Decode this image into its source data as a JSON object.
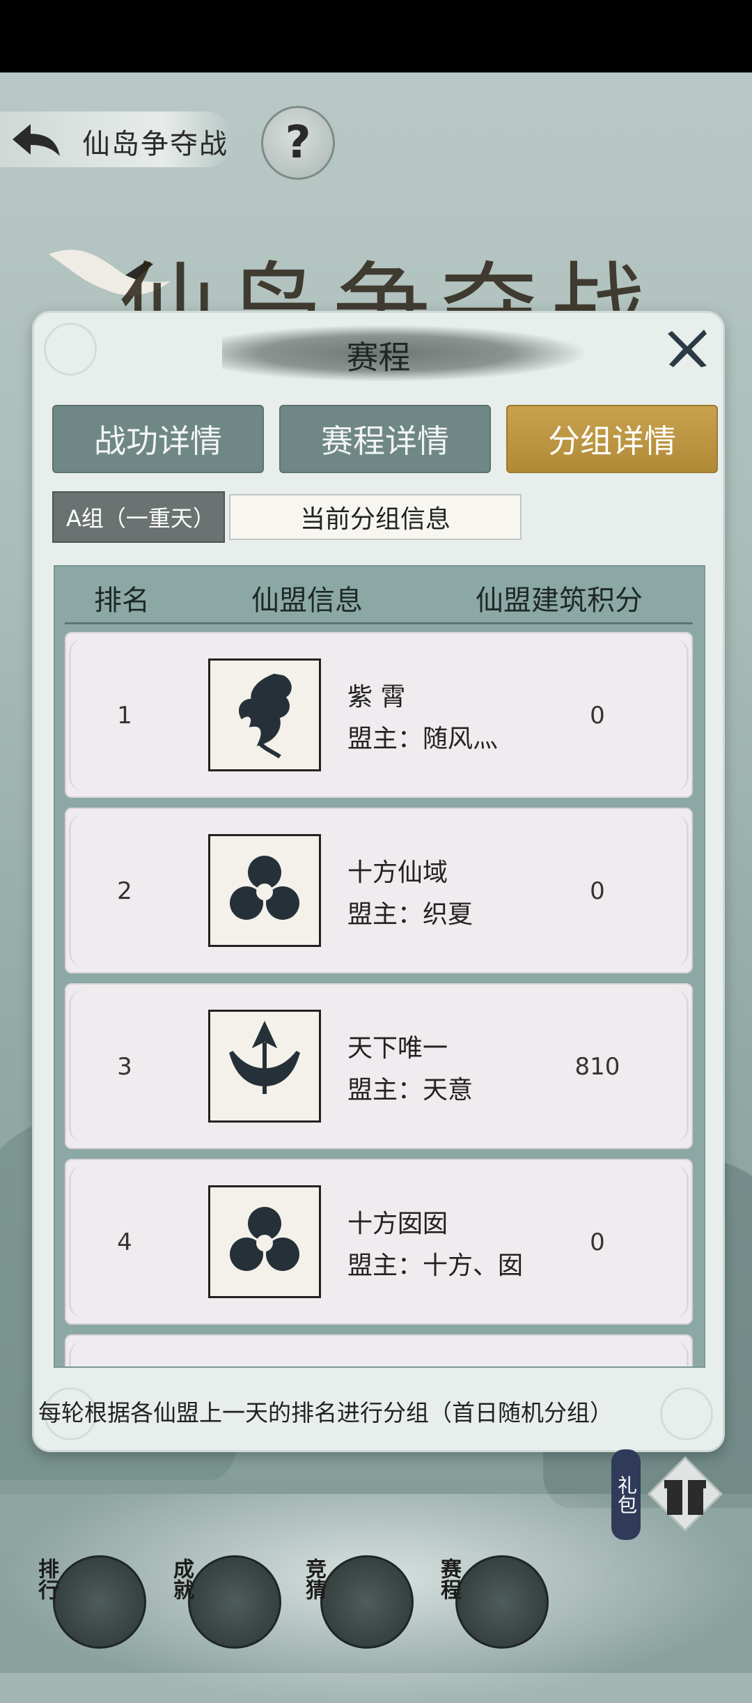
{
  "header": {
    "title": "仙岛争夺战",
    "help_label": "?"
  },
  "banner": {
    "title": "仙岛争夺战"
  },
  "dialog": {
    "title": "赛程",
    "tabs": [
      {
        "label": "战功详情",
        "active": false
      },
      {
        "label": "赛程详情",
        "active": false
      },
      {
        "label": "分组详情",
        "active": true
      }
    ],
    "group": {
      "selected": "A组（一重天）",
      "info": "当前分组信息"
    },
    "table": {
      "columns": [
        "排名",
        "仙盟信息",
        "仙盟建筑积分"
      ],
      "rows": [
        {
          "rank": "1",
          "name": "紫 霄",
          "leader": "盟主：随风灬",
          "score": "0",
          "emblem": "dragon-emblem-icon"
        },
        {
          "rank": "2",
          "name": "十方仙域",
          "leader": "盟主：织夏",
          "score": "0",
          "emblem": "trefoil-emblem-icon"
        },
        {
          "rank": "3",
          "name": "天下唯一",
          "leader": "盟主：天意",
          "score": "810",
          "emblem": "phoenix-emblem-icon"
        },
        {
          "rank": "4",
          "name": "十方囡囡",
          "leader": "盟主：十方、囡",
          "score": "0",
          "emblem": "trefoil-emblem-icon"
        }
      ]
    },
    "footer_note": "每轮根据各仙盟上一天的排名进行分组（首日随机分组）"
  },
  "side": {
    "gift_label": "礼包"
  },
  "bottom_nav": [
    {
      "label": "排行",
      "icon": "banner-icon"
    },
    {
      "label": "成就",
      "icon": "scroll-icon"
    },
    {
      "label": "竞猜",
      "icon": "orb-icon"
    },
    {
      "label": "赛程",
      "icon": "gate-icon"
    }
  ]
}
